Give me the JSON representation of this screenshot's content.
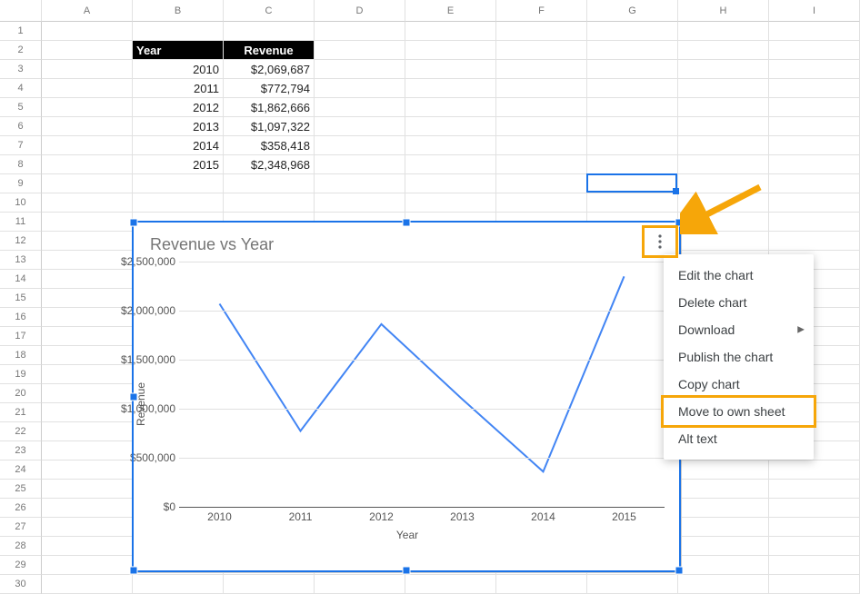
{
  "columns": [
    "A",
    "B",
    "C",
    "D",
    "E",
    "F",
    "G",
    "H",
    "I"
  ],
  "row_count": 30,
  "selected_cell": "G9",
  "table": {
    "header": {
      "year": "Year",
      "revenue": "Revenue"
    },
    "rows": [
      {
        "year": "2010",
        "revenue": "$2,069,687"
      },
      {
        "year": "2011",
        "revenue": "$772,794"
      },
      {
        "year": "2012",
        "revenue": "$1,862,666"
      },
      {
        "year": "2013",
        "revenue": "$1,097,322"
      },
      {
        "year": "2014",
        "revenue": "$358,418"
      },
      {
        "year": "2015",
        "revenue": "$2,348,968"
      }
    ]
  },
  "chart_data": {
    "type": "line",
    "title": "Revenue vs Year",
    "xlabel": "Year",
    "ylabel": "Revenue",
    "categories": [
      "2010",
      "2011",
      "2012",
      "2013",
      "2014",
      "2015"
    ],
    "values": [
      2069687,
      772794,
      1862666,
      1097322,
      358418,
      2348968
    ],
    "yticks_labels": [
      "$0",
      "$500,000",
      "$1,000,000",
      "$1,500,000",
      "$2,000,000",
      "$2,500,000"
    ],
    "yticks_values": [
      0,
      500000,
      1000000,
      1500000,
      2000000,
      2500000
    ],
    "ylim": [
      0,
      2500000
    ]
  },
  "menu": {
    "items": [
      {
        "label": "Edit the chart",
        "submenu": false
      },
      {
        "label": "Delete chart",
        "submenu": false
      },
      {
        "label": "Download",
        "submenu": true
      },
      {
        "label": "Publish the chart",
        "submenu": false
      },
      {
        "label": "Copy chart",
        "submenu": false
      },
      {
        "label": "Move to own sheet",
        "submenu": false,
        "highlight": true
      },
      {
        "label": "Alt text",
        "submenu": false
      }
    ]
  }
}
